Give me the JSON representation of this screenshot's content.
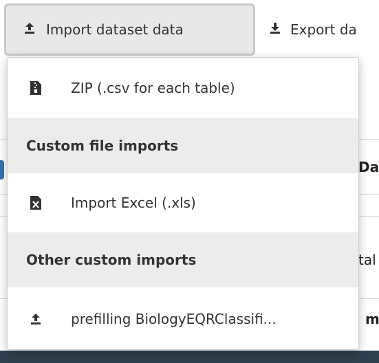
{
  "toolbar": {
    "import_label": "Import dataset data",
    "export_label": "Export da"
  },
  "menu": {
    "items": [
      {
        "label": "ZIP (.csv for each table)",
        "icon": "file-zip-icon"
      }
    ],
    "sections": [
      {
        "header": "Custom file imports",
        "items": [
          {
            "label": "Import Excel (.xls)",
            "icon": "file-excel-icon"
          }
        ]
      },
      {
        "header": "Other custom imports",
        "items": [
          {
            "label": "prefilling BiologyEQRClassifi...",
            "icon": "upload-icon"
          }
        ]
      }
    ]
  },
  "background": {
    "fragment_1": "Da",
    "fragment_2": "tal",
    "fragment_3": "m"
  },
  "colors": {
    "header_bg": "#ececec",
    "button_bg": "#e8e8e8",
    "bottom_bar": "#2f3f4c",
    "accent_blue": "#3572b0"
  }
}
